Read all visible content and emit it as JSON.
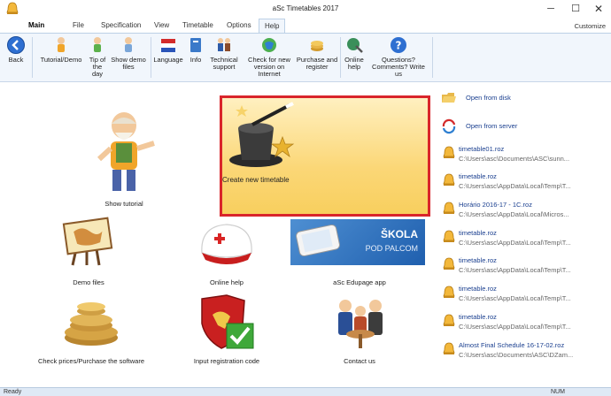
{
  "window": {
    "title": "aSc Timetables 2017",
    "minimize_glyph": "─",
    "maximize_glyph": "☐",
    "close_glyph": "✕"
  },
  "menu": {
    "main": "Main",
    "file": "File",
    "specification": "Specification",
    "view": "View",
    "timetable": "Timetable",
    "options": "Options",
    "help": "Help",
    "customize": "Customize"
  },
  "ribbon": {
    "back": "Back",
    "tutorial": "Tutorial/Demo",
    "tip_line1": "Tip of",
    "tip_line2": "the day",
    "demo_line1": "Show demo",
    "demo_line2": "files",
    "language": "Language",
    "info": "Info",
    "tech_line1": "Technical",
    "tech_line2": "support",
    "check_line1": "Check for new",
    "check_line2": "version on Internet",
    "purchase_line1": "Purchase and",
    "purchase_line2": "register",
    "online_line1": "Online",
    "online_line2": "help",
    "questions_line1": "Questions?",
    "questions_line2": "Comments? Write us"
  },
  "tiles": {
    "tutorial": "Show tutorial",
    "create": "Create new timetable",
    "demo": "Demo files",
    "online_help": "Online help",
    "edupage": "aSc Edupage app",
    "edupage_banner_line1": "ŠKOLA",
    "edupage_banner_line2": "POD PALCOM",
    "prices": "Check prices/Purchase the software",
    "registration": "Input registration code",
    "contact": "Contact us"
  },
  "recent": {
    "open_disk": "Open from disk",
    "open_server": "Open from server",
    "files": [
      {
        "name": "timetable01.roz",
        "path": "C:\\Users\\asc\\Documents\\ASC\\sunn..."
      },
      {
        "name": "timetable.roz",
        "path": "C:\\Users\\asc\\AppData\\Local\\Temp\\T..."
      },
      {
        "name": "Horário 2016-17 - 1C.roz",
        "path": "C:\\Users\\asc\\AppData\\Local\\Micros..."
      },
      {
        "name": "timetable.roz",
        "path": "C:\\Users\\asc\\AppData\\Local\\Temp\\T..."
      },
      {
        "name": "timetable.roz",
        "path": "C:\\Users\\asc\\AppData\\Local\\Temp\\T..."
      },
      {
        "name": "timetable.roz",
        "path": "C:\\Users\\asc\\AppData\\Local\\Temp\\T..."
      },
      {
        "name": "timetable.roz",
        "path": "C:\\Users\\asc\\AppData\\Local\\Temp\\T..."
      },
      {
        "name": "Almost Final Schedule 16-17-02.roz",
        "path": "C:\\Users\\asc\\Documents\\ASC\\DZam..."
      }
    ]
  },
  "status": {
    "ready": "Ready",
    "num": "NUM"
  },
  "colors": {
    "accent_red": "#d9252b",
    "ribbon_bg": "#f1f6fc",
    "link_blue": "#1a3f8f"
  }
}
